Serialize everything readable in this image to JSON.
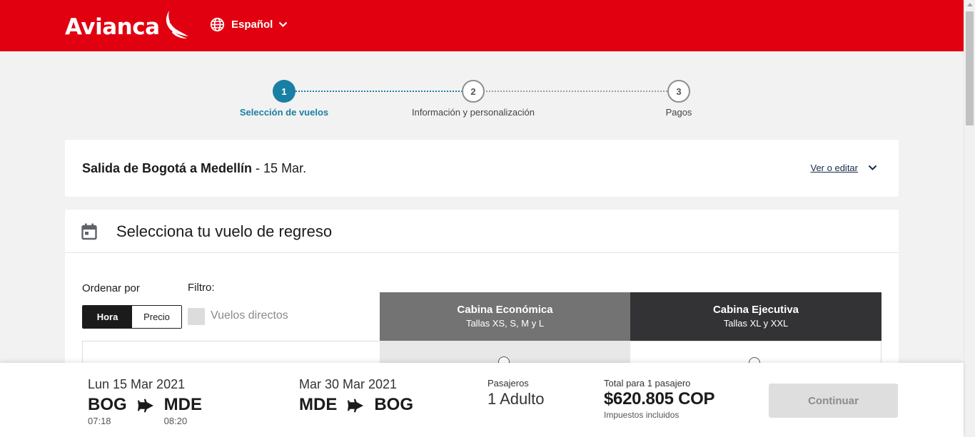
{
  "header": {
    "brand": "Avianca",
    "language": "Español"
  },
  "stepper": {
    "steps": [
      {
        "number": "1",
        "label": "Selección de vuelos",
        "state": "active"
      },
      {
        "number": "2",
        "label": "Información y personalización",
        "state": "pending"
      },
      {
        "number": "3",
        "label": "Pagos",
        "state": "pending"
      }
    ]
  },
  "outbound": {
    "title": "Salida de Bogotá a Medellín",
    "date_suffix": " - 15 Mar.",
    "edit_link": "Ver o editar"
  },
  "return_section": {
    "title": "Selecciona tu vuelo de regreso",
    "sort_label": "Ordenar por",
    "sort_options": [
      "Hora",
      "Precio"
    ],
    "sort_selected": "Hora",
    "filter_label": "Filtro:",
    "direct_flights_label": "Vuelos directos",
    "direct_flights_checked": false,
    "cabins": [
      {
        "name": "Cabina Económica",
        "sizes": "Tallas XS, S, M y L"
      },
      {
        "name": "Cabina Ejecutiva",
        "sizes": "Tallas XL y XXL"
      }
    ]
  },
  "summary": {
    "outbound": {
      "date": "Lun 15 Mar 2021",
      "origin": "BOG",
      "origin_time": "07:18",
      "destination": "MDE",
      "destination_time": "08:20"
    },
    "inbound": {
      "date": "Mar 30 Mar 2021",
      "origin": "MDE",
      "destination": "BOG"
    },
    "passengers_label": "Pasajeros",
    "passengers_value": "1 Adulto",
    "total_label": "Total para 1 pasajero",
    "total_amount": "$620.805 COP",
    "taxes_note": "Impuestos incluidos",
    "continue_label": "Continuar"
  },
  "colors": {
    "brand_red": "#e1000f",
    "step_active": "#1a7fa4",
    "cabin_economy": "#737373",
    "cabin_executive": "#333235"
  },
  "icons": [
    "avianca-bird-logo",
    "globe-icon",
    "chevron-down-icon",
    "calendar-icon",
    "plane-icon"
  ]
}
